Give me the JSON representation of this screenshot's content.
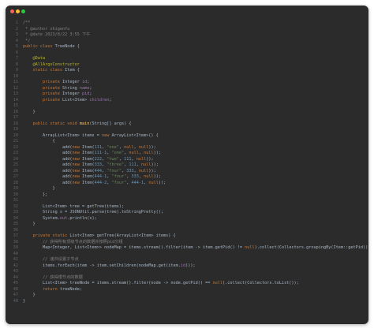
{
  "window_buttons": [
    {
      "name": "close",
      "color": "#ff5f56"
    },
    {
      "name": "minimize",
      "color": "#ffbd2e"
    },
    {
      "name": "zoom",
      "color": "#27c93f"
    }
  ],
  "syntax_colors": {
    "text": "#a9b7c6",
    "keyword": "#cc7832",
    "comment": "#808080",
    "string": "#6a8759",
    "number": "#6897bb",
    "annotation": "#bbb529",
    "field": "#9876aa",
    "method": "#ffc66d",
    "line_number": "#606366"
  },
  "code_lines": [
    "/**",
    " * @author shigenfu",
    " * @date 2023/8/22 3:55 下午",
    " */",
    "public class TreeNode {",
    "",
    "    @Data",
    "    @AllArgsConstructor",
    "    static class Item {",
    "",
    "        private Integer id;",
    "        private String name;",
    "        private Integer pid;",
    "        private List<Item> children;",
    "",
    "    }",
    "",
    "    public static void main(String[] args) {",
    "",
    "        ArrayList<Item> items = new ArrayList<Item>() {",
    "            {",
    "                add(new Item(111, \"one\", null, null));",
    "                add(new Item(111-1, \"one\", null, null));",
    "                add(new Item(222, \"two\", 111, null));",
    "                add(new Item(333, \"three\", 111, null));",
    "                add(new Item(444, \"four\", 333, null));",
    "                add(new Item(444-1, \"four\", 333, null));",
    "                add(new Item(444-2, \"four\", 444-1, null));",
    "            }",
    "        };",
    "",
    "        List<Item> tree = getTree(items);",
    "        String s = JSONUtil.parse(tree).toStringPretty();",
    "        System.out.println(s);",
    "    }",
    "",
    "    private static List<Item> getTree(ArrayList<Item> items) {",
    "        // 获得所有顶级节点的数据并按照pid分组",
    "        Map<Integer, List<Item>> nodeMap = items.stream().filter(item -> item.getPid() != null).collect(Collectors.groupingBy(Item::getPid));",
    "",
    "        // 递归设置子节点",
    "        items.forEach(item -> item.setChildren(nodeMap.get(item.id)));",
    "",
    "        // 获得根节点的数据",
    "        List<Item> treeNode = items.stream().filter(node -> node.getPid() == null).collect(Collectors.toList());",
    "        return treeNode;",
    "    }",
    "}"
  ]
}
